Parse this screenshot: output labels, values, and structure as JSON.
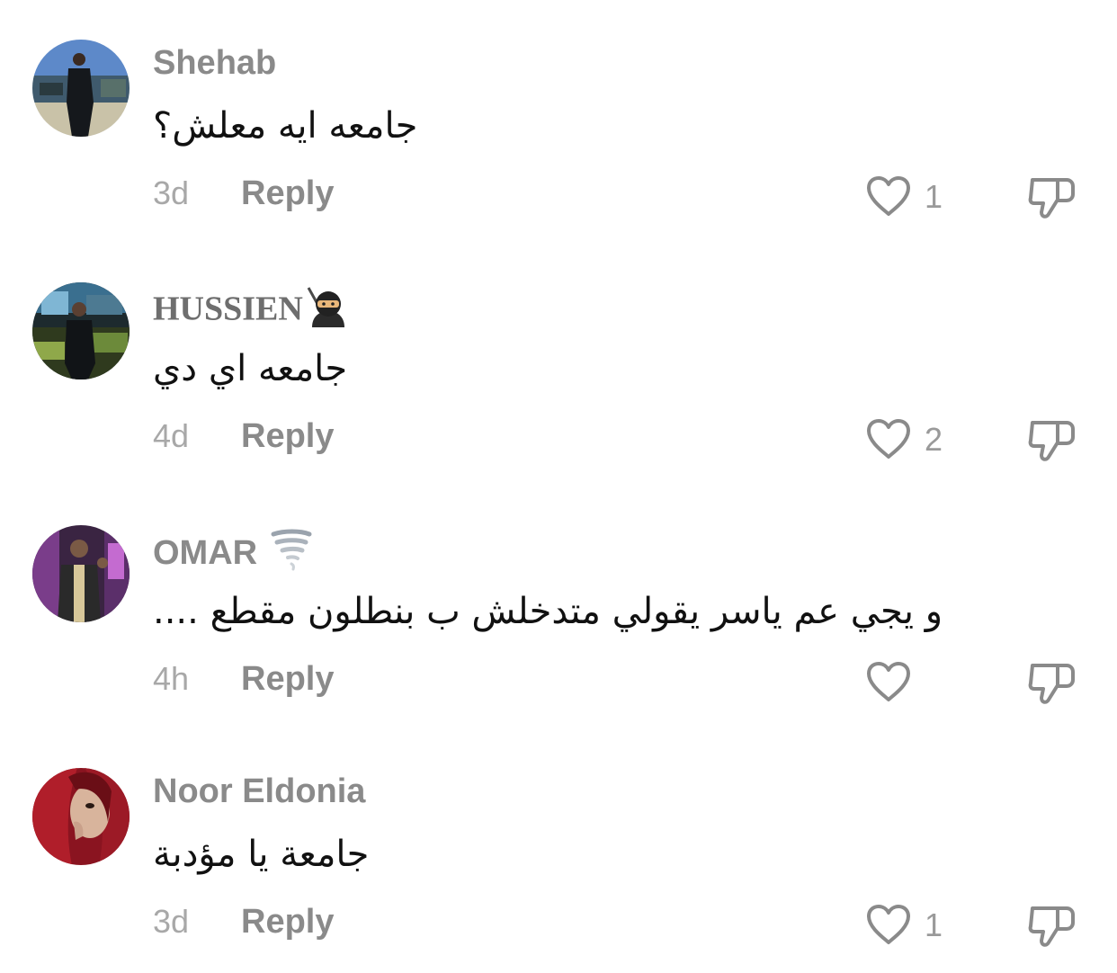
{
  "comments": [
    {
      "username": "Shehab",
      "text": "جامعه ايه معلش؟",
      "time": "3d",
      "reply_label": "Reply",
      "likes": "1"
    },
    {
      "username": "HUSSIEN",
      "username_emoji": "ninja-emoji",
      "text": "جامعه اي دي",
      "time": "4d",
      "reply_label": "Reply",
      "likes": "2"
    },
    {
      "username": "OMAR",
      "username_emoji": "tornado-emoji",
      "text": "و يجي عم ياسر يقولي متدخلش ب بنطلون مقطع ....",
      "time": "4h",
      "reply_label": "Reply",
      "likes": ""
    },
    {
      "username": "Noor Eldonia",
      "text": "جامعة يا مؤدبة",
      "time": "3d",
      "reply_label": "Reply",
      "likes": "1"
    }
  ],
  "icons": {
    "like": "heart-icon",
    "dislike": "thumbs-down-icon"
  },
  "colors": {
    "username": "#8a8a8a",
    "text": "#111111",
    "meta": "#a8a8a8",
    "icon": "#8a8a8a"
  }
}
